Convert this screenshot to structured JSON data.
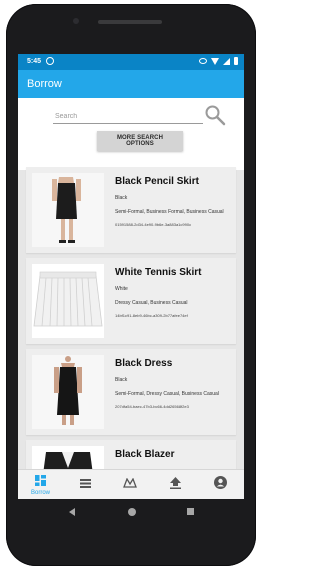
{
  "status": {
    "time": "5:45"
  },
  "appbar": {
    "title": "Borrow"
  },
  "search": {
    "placeholder": "Search",
    "value": "",
    "more_label": "MORE SEARCH OPTIONS"
  },
  "items": [
    {
      "name": "Black Pencil Skirt",
      "color": "Black",
      "occasions": "Semi-Formal, Business Formal, Business Casual",
      "id": "01591588-2d34-4e90-9b6e-3a883a1c990c",
      "icon": "pencil-skirt-image"
    },
    {
      "name": "White Tennis Skirt",
      "color": "White",
      "occasions": "Dressy Casual, Business Casual",
      "id": "14bf1c91-8eb9-46bc-a309-2b77afee74ef",
      "icon": "tennis-skirt-image"
    },
    {
      "name": "Black Dress",
      "color": "Black",
      "occasions": "Semi-Formal, Dressy Casual, Business Casual",
      "id": "207dfa54-baec-47b3-bc66-4dd26568f2e3",
      "icon": "black-dress-image"
    },
    {
      "name": "Black Blazer",
      "color": "",
      "occasions": "",
      "id": "",
      "icon": "blazer-image"
    }
  ],
  "bottom_nav": {
    "borrow_label": "Borrow",
    "items": [
      "dashboard-icon",
      "list-icon",
      "hanger-icon",
      "upload-icon",
      "account-icon"
    ]
  },
  "colors": {
    "appbar": "#23a7e9",
    "statusbar": "#0a84c6",
    "accent": "#23a7e9"
  }
}
